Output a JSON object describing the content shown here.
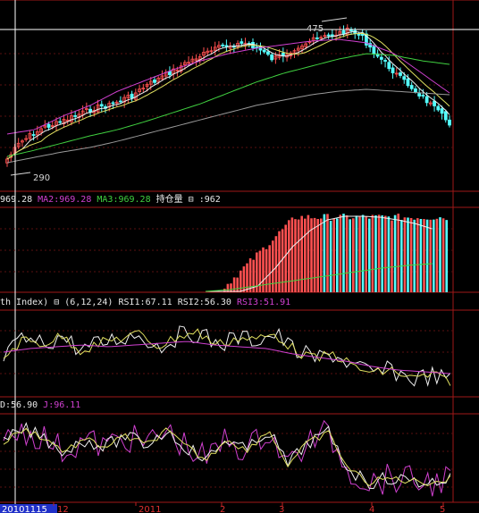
{
  "price_panel": {
    "high_label": "475",
    "low_label": "290"
  },
  "volume_panel": {
    "header": [
      {
        "text": "969.28",
        "color": "#e8e8e8"
      },
      {
        "text": "MA2:969.28",
        "color": "#d040d0"
      },
      {
        "text": "MA3:969.28",
        "color": "#40d040"
      },
      {
        "text": "持仓量",
        "color": "#e8e8e8"
      },
      {
        "text": "⊟",
        "color": "#e8e8e8"
      },
      {
        "text": ":962",
        "color": "#e8e8e8"
      }
    ]
  },
  "rsi_panel": {
    "header": [
      {
        "text": "th Index)",
        "color": "#e8e8e8"
      },
      {
        "text": "⊟",
        "color": "#e8e8e8"
      },
      {
        "text": "(6,12,24)",
        "color": "#e8e8e8"
      },
      {
        "text": "RSI1:67.11",
        "color": "#e8e8e8"
      },
      {
        "text": "RSI2:56.30",
        "color": "#e8e8e8"
      },
      {
        "text": "RSI3:51.91",
        "color": "#d040d0"
      }
    ]
  },
  "kdj_panel": {
    "header": [
      {
        "text": "D:56.90",
        "color": "#e8e8e8"
      },
      {
        "text": "J:96.11",
        "color": "#d040d0"
      }
    ]
  },
  "date_axis": {
    "selected_date": "20101115",
    "labels": [
      "12",
      "2011",
      "2",
      "3",
      "4",
      "5"
    ]
  },
  "colors": {
    "up_candle": "#ff5050",
    "down_candle": "#54ffff",
    "panel_border": "#a01818",
    "grid": "#5a1010",
    "ma1": "#e8e8e8",
    "ma_magenta": "#d040d0",
    "ma_green": "#40d040",
    "ma_long": "#9a9a9a"
  }
}
